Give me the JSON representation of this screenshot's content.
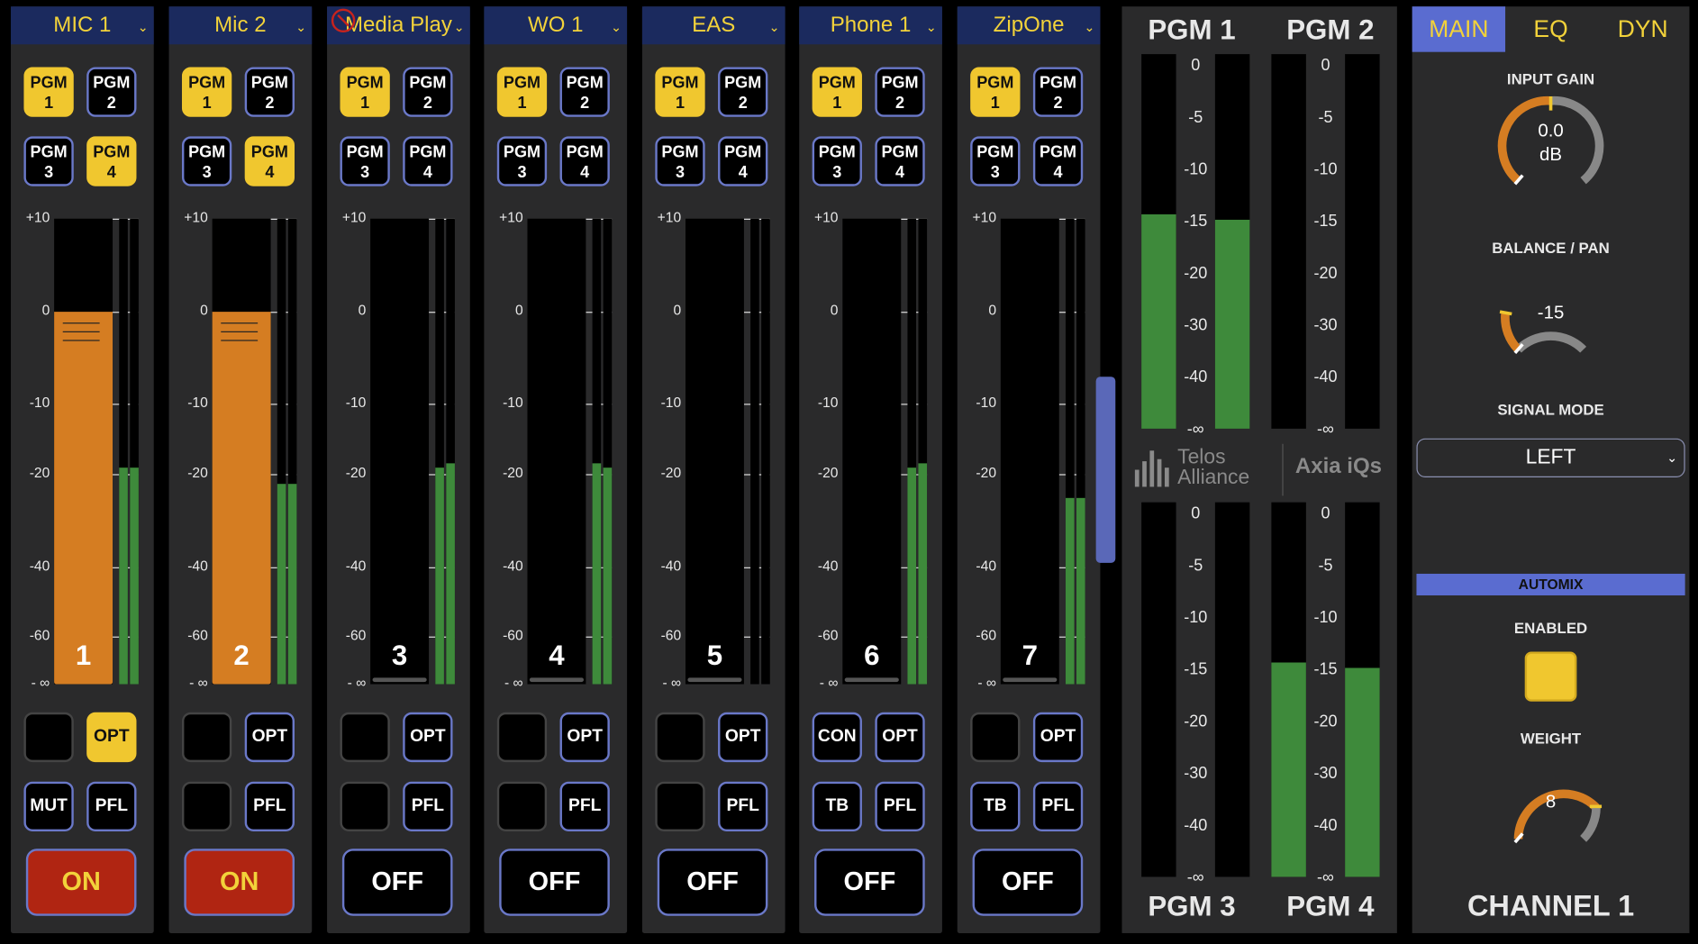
{
  "strips": [
    {
      "name": "MIC 1",
      "pgm": [
        "PGM 1",
        "PGM 2",
        "PGM 3",
        "PGM 4"
      ],
      "pgm_on": [
        true,
        false,
        false,
        true
      ],
      "number": "1",
      "fader_level": "0",
      "meter_levels": [
        -19,
        -19
      ],
      "btn_top_left": "",
      "btn_top_right": "OPT",
      "opt_active": true,
      "btn_bot_left": "MUT",
      "btn_bot_right": "PFL",
      "state": "ON"
    },
    {
      "name": "Mic 2",
      "pgm": [
        "PGM 1",
        "PGM 2",
        "PGM 3",
        "PGM 4"
      ],
      "pgm_on": [
        true,
        false,
        false,
        true
      ],
      "number": "2",
      "fader_level": "0",
      "meter_levels": [
        -22,
        -22
      ],
      "btn_top_left": "",
      "btn_top_right": "OPT",
      "opt_active": false,
      "btn_bot_left": "",
      "btn_bot_right": "PFL",
      "state": "ON"
    },
    {
      "name": "Media Play",
      "pgm": [
        "PGM 1",
        "PGM 2",
        "PGM 3",
        "PGM 4"
      ],
      "pgm_on": [
        true,
        false,
        false,
        false
      ],
      "number": "3",
      "fader_level": "-∞",
      "meter_levels": [
        -19,
        -18.5
      ],
      "btn_top_left": "",
      "btn_top_right": "OPT",
      "opt_active": false,
      "btn_bot_left": "",
      "btn_bot_right": "PFL",
      "state": "OFF",
      "warn_icon": true
    },
    {
      "name": "WO 1",
      "pgm": [
        "PGM 1",
        "PGM 2",
        "PGM 3",
        "PGM 4"
      ],
      "pgm_on": [
        true,
        false,
        false,
        false
      ],
      "number": "4",
      "fader_level": "-∞",
      "meter_levels": [
        -18.5,
        -19
      ],
      "btn_top_left": "",
      "btn_top_right": "OPT",
      "opt_active": false,
      "btn_bot_left": "",
      "btn_bot_right": "PFL",
      "state": "OFF"
    },
    {
      "name": "EAS",
      "pgm": [
        "PGM 1",
        "PGM 2",
        "PGM 3",
        "PGM 4"
      ],
      "pgm_on": [
        true,
        false,
        false,
        false
      ],
      "number": "5",
      "fader_level": "-∞",
      "meter_levels": [
        null,
        null
      ],
      "btn_top_left": "",
      "btn_top_right": "OPT",
      "opt_active": false,
      "btn_bot_left": "",
      "btn_bot_right": "PFL",
      "state": "OFF"
    },
    {
      "name": "Phone 1",
      "pgm": [
        "PGM 1",
        "PGM 2",
        "PGM 3",
        "PGM 4"
      ],
      "pgm_on": [
        true,
        false,
        false,
        false
      ],
      "number": "6",
      "fader_level": "-∞",
      "meter_levels": [
        -19,
        -18.5
      ],
      "btn_top_left": "CON",
      "btn_top_right": "OPT",
      "opt_active": false,
      "btn_bot_left": "TB",
      "btn_bot_right": "PFL",
      "state": "OFF"
    },
    {
      "name": "ZipOne",
      "pgm": [
        "PGM 1",
        "PGM 2",
        "PGM 3",
        "PGM 4"
      ],
      "pgm_on": [
        true,
        false,
        false,
        false
      ],
      "number": "7",
      "fader_level": "-∞",
      "meter_levels": [
        -25,
        -25
      ],
      "btn_top_left": "",
      "btn_top_right": "OPT",
      "opt_active": false,
      "btn_bot_left": "TB",
      "btn_bot_right": "PFL",
      "state": "OFF"
    }
  ],
  "fader_scale": [
    "+10",
    "0",
    "-10",
    "-20",
    "-40",
    "-60",
    "- ∞"
  ],
  "meters_panel": {
    "titles": [
      "PGM 1",
      "PGM 2",
      "PGM 3",
      "PGM 4"
    ],
    "scale": [
      "0",
      "-5",
      "-10",
      "-15",
      "-20",
      "-30",
      "-40",
      "-∞"
    ],
    "levels": {
      "pgm1": [
        -15,
        -15.5
      ],
      "pgm2": [
        null,
        null
      ],
      "pgm3": [
        null,
        null
      ],
      "pgm4": [
        -15,
        -15.5
      ]
    },
    "brand_left": "Telos Alliance",
    "brand_right": "Axia iQs"
  },
  "channel_panel": {
    "tabs": [
      "MAIN",
      "EQ",
      "DYN"
    ],
    "active_tab": "MAIN",
    "input_gain_label": "INPUT GAIN",
    "input_gain_value": "0.0",
    "input_gain_unit": "dB",
    "balance_label": "BALANCE / PAN",
    "balance_value": "-15",
    "signal_mode_label": "SIGNAL MODE",
    "signal_mode_value": "LEFT",
    "automix_label": "AUTOMIX",
    "enabled_label": "ENABLED",
    "enabled": true,
    "weight_label": "WEIGHT",
    "weight_value": "8",
    "channel_title": "CHANNEL 1"
  },
  "colors": {
    "accent": "#f0c72f",
    "fader": "#d57d22",
    "meter": "#3e8a3b",
    "on_red": "#b02512",
    "outline": "#6a78c8",
    "header": "#1b2a5e",
    "tab_active": "#5a6cd0"
  }
}
